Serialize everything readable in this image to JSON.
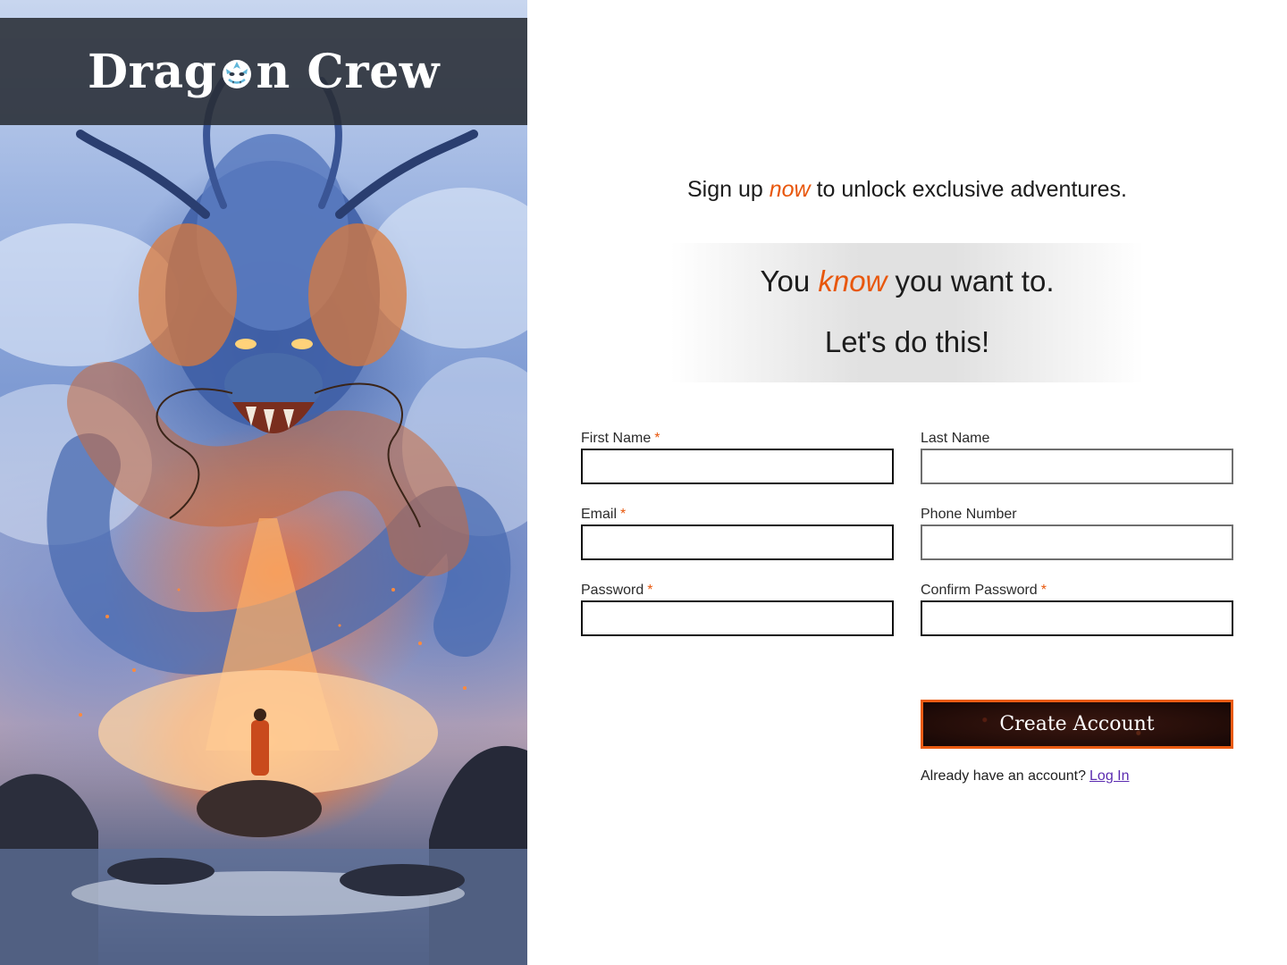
{
  "brand": {
    "name_before": "Drag",
    "name_after": "n Crew",
    "logo_icon": "dragon-head-icon"
  },
  "hero": {
    "image": "dragon-illustration"
  },
  "tagline": {
    "before": "Sign up ",
    "accent": "now",
    "after": " to unlock exclusive adventures."
  },
  "banner": {
    "line1_before": "You ",
    "line1_accent": "know",
    "line1_after": " you want to.",
    "line2": "Let's do this!"
  },
  "form": {
    "first_name": {
      "label": "First Name",
      "required_mark": "*",
      "value": ""
    },
    "last_name": {
      "label": "Last Name",
      "value": ""
    },
    "email": {
      "label": "Email",
      "required_mark": "*",
      "value": ""
    },
    "phone": {
      "label": "Phone Number",
      "value": ""
    },
    "password": {
      "label": "Password",
      "required_mark": "*",
      "value": ""
    },
    "confirm_password": {
      "label": "Confirm Password",
      "required_mark": "*",
      "value": ""
    },
    "submit_label": "Create Account"
  },
  "login": {
    "prompt": "Already have an account?",
    "link_label": "Log In"
  },
  "colors": {
    "accent": "#e8570c",
    "link": "#5b2bb0",
    "button_border": "#ea5b12",
    "brand_bar": "#282c34"
  }
}
